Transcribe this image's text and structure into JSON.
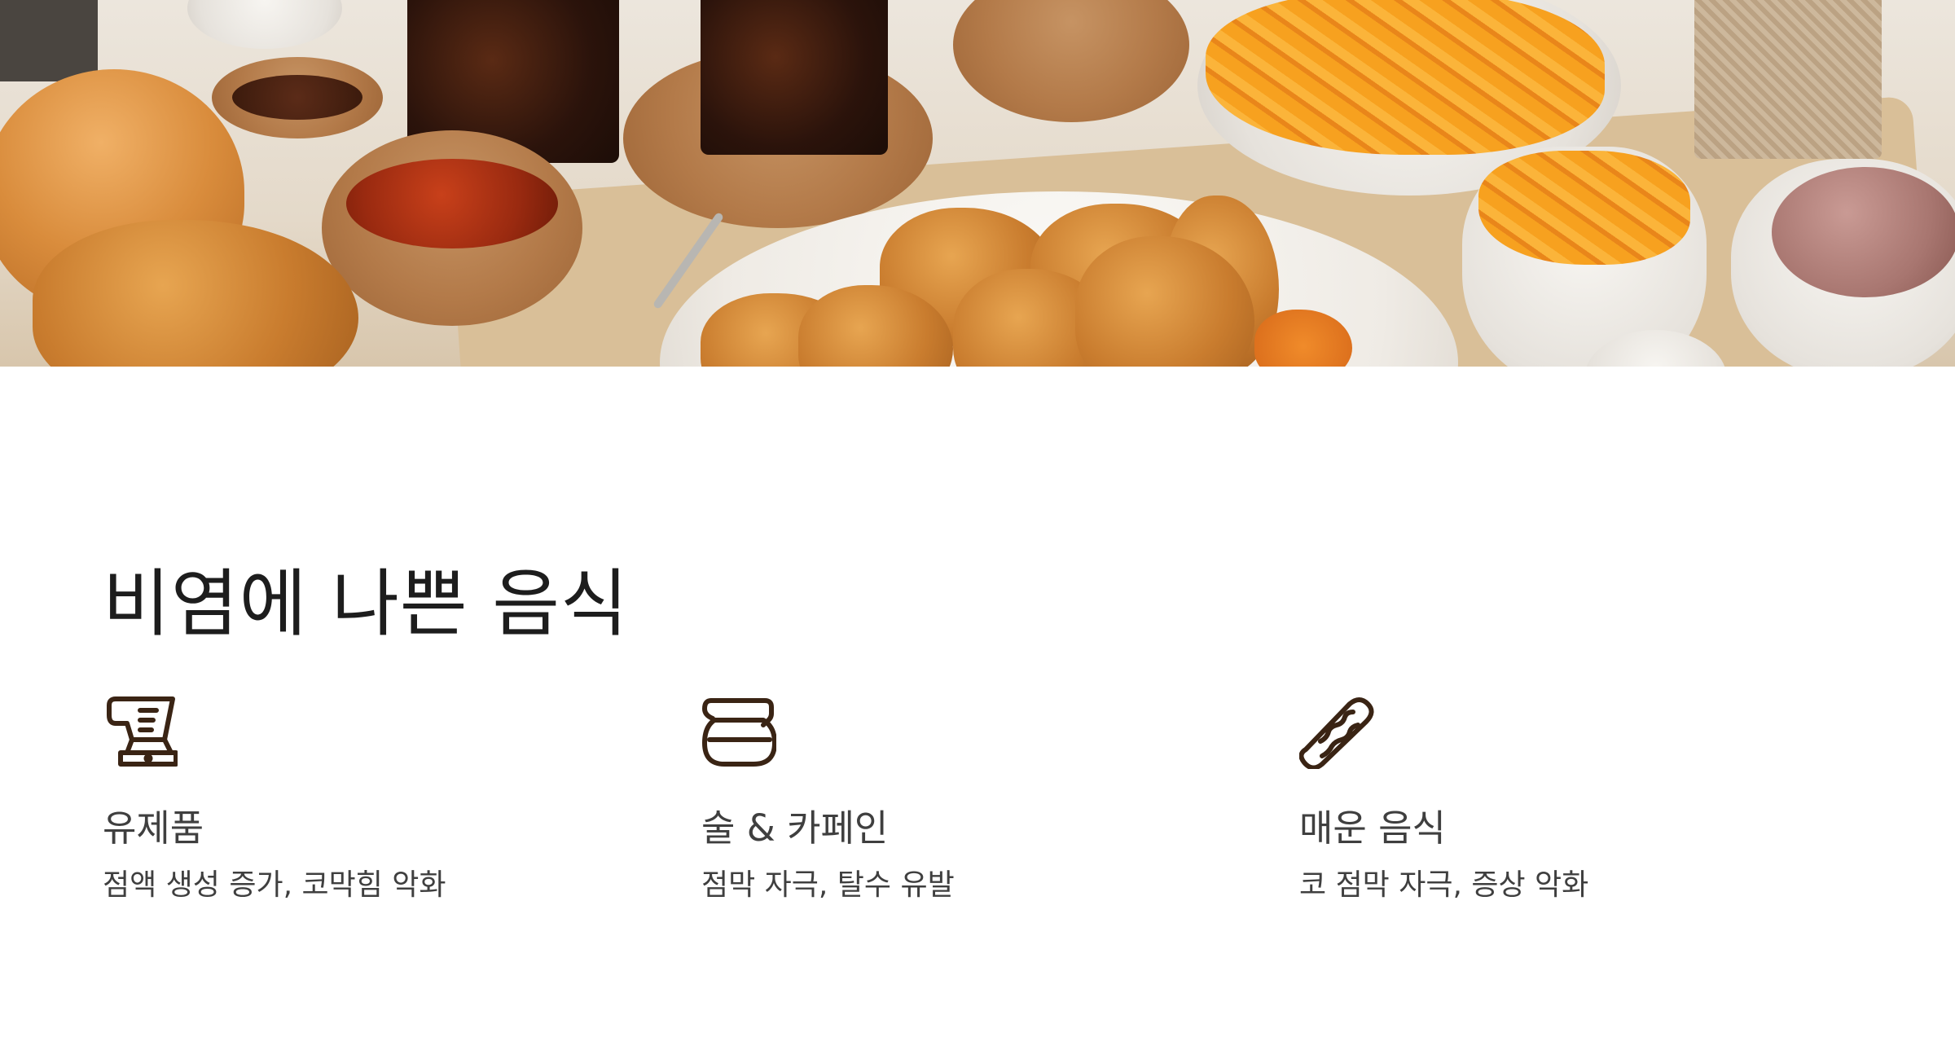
{
  "hero": {
    "image_description_icon": "food-photo"
  },
  "page": {
    "title": "비염에 나쁜 음식"
  },
  "features": [
    {
      "icon": "blender-icon",
      "title": "유제품",
      "description": "점액 생성 증가, 코막힘 악화"
    },
    {
      "icon": "coffee-pot-icon",
      "title": "술 & 카페인",
      "description": "점막 자극, 탈수 유발"
    },
    {
      "icon": "chili-pepper-icon",
      "title": "매운 음식",
      "description": "코 점막 자극, 증상 악화"
    }
  ],
  "colors": {
    "icon": "#3a2414",
    "title_text": "#1d1d1d",
    "body_text": "#3f3f3f",
    "background": "#ffffff"
  }
}
